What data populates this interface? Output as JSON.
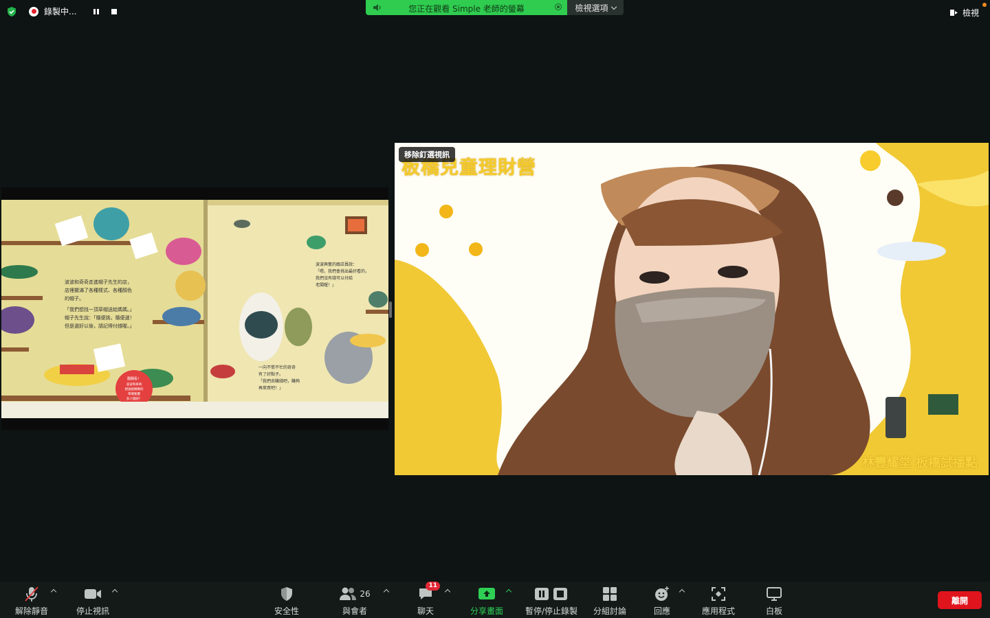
{
  "top_bar": {
    "recording_label": "錄製中...",
    "share_banner_text": "您正在觀看 Simple 老師的螢幕",
    "view_options_label": "檢視選項",
    "view_label": "檢視"
  },
  "shared_screen": {
    "book_text_left": [
      "波波和奇奇走進帽子先生的店，",
      "店裡擺滿了各種樣式、各種顏色",
      "的帽子。",
      "「我們想找一頂草帽送給媽媽。」",
      "帽子先生說：「隨便挑，隨便選！",
      "但是選好以後，請記得付錢喔。」"
    ],
    "book_text_right": [
      "波波興奮的跟店員說：",
      "「嗯，我們會挑出最好看的，",
      "我們沒有錢可以付給",
      "老闆喔！」"
    ],
    "book_text_right_bottom": [
      "一向不慌不忙的奇奇",
      "有了好點子。",
      "「我們去賺錢吧，賺夠",
      "再來買吧！」"
    ],
    "sticker_text": [
      "翻翻看！",
      "波波和奇奇",
      "想送給媽媽的",
      "草帽要賣",
      "多少錢呢？"
    ]
  },
  "video": {
    "remove_tag": "移除釘選視訊",
    "title": "板橋兒童理財營",
    "footer": "林豐耀堂 板橋試播點"
  },
  "toolbar": {
    "unmute_label": "解除靜音",
    "stop_video_label": "停止視訊",
    "security_label": "安全性",
    "participants_label": "與會者",
    "participants_count": "26",
    "chat_label": "聊天",
    "chat_badge": "11",
    "share_label": "分享畫面",
    "pause_rec_label": "暫停/停止錄製",
    "breakout_label": "分組討論",
    "reactions_label": "回應",
    "apps_label": "應用程式",
    "whiteboard_label": "白板",
    "leave_label": "離開"
  },
  "colors": {
    "share_green": "#2fcc50",
    "leave_red": "#e0141c",
    "badge_red": "#e22734",
    "video_yellow": "#f4cb2c"
  }
}
